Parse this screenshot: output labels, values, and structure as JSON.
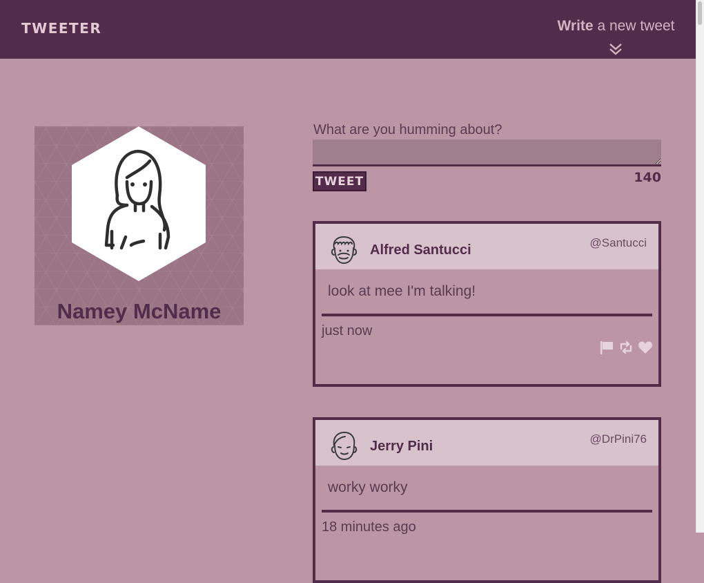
{
  "nav": {
    "brand": "TWEETER",
    "compose_toggle": {
      "bold": "Write",
      "rest": " a new tweet",
      "icon": "double-chevron-down-icon"
    }
  },
  "profile": {
    "name": "Namey McName",
    "avatar_icon": "woman-avatar-icon"
  },
  "new_tweet": {
    "title": "What are you humming about?",
    "value": "",
    "button_label": "TWEET",
    "counter": "140"
  },
  "tweets": [
    {
      "name": "Alfred Santucci",
      "handle": "@Santucci",
      "text": "look at mee I'm talking!",
      "time": "just now",
      "avatar_icon": "curly-hair-man-avatar-icon",
      "actions": [
        "flag-icon",
        "retweet-icon",
        "heart-icon"
      ]
    },
    {
      "name": "Jerry Pini",
      "handle": "@DrPini76",
      "text": "worky worky",
      "time": "18 minutes ago",
      "avatar_icon": "man-avatar-icon"
    }
  ],
  "colors": {
    "primary": "#532b4b",
    "background": "#bc96a4",
    "tweet_header": "#d8c3cc",
    "input": "#a07f8d"
  }
}
